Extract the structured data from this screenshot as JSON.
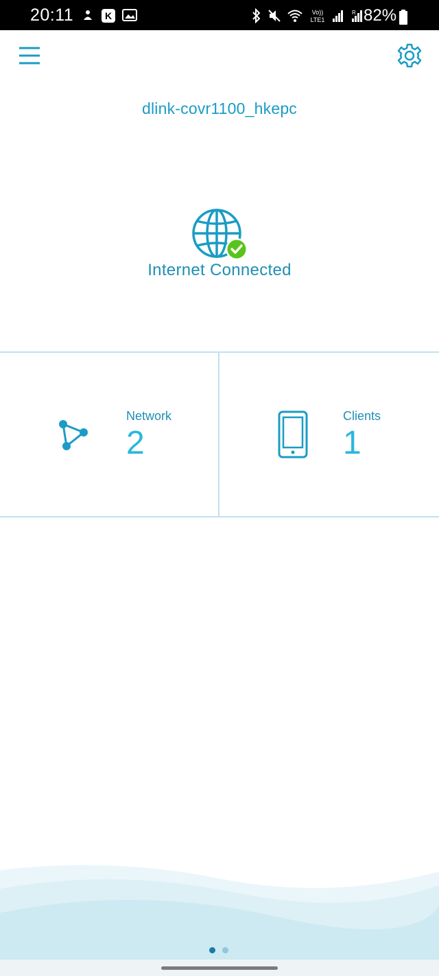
{
  "status_bar": {
    "time": "20:11",
    "battery": "82%",
    "left_icons": [
      "notification-icon",
      "k-app-icon",
      "gallery-icon"
    ],
    "right_icons": [
      "bluetooth-icon",
      "mute-icon",
      "wifi-icon",
      "volte-icon",
      "signal-icon",
      "roaming-signal-icon"
    ]
  },
  "header": {
    "menu_icon": "hamburger-menu-icon",
    "settings_icon": "gear-icon"
  },
  "network": {
    "name": "dlink-covr1100_hkepc"
  },
  "internet": {
    "status": "Internet Connected",
    "icon": "globe-icon",
    "badge_icon": "check-icon",
    "badge_color": "#5ac31b"
  },
  "tiles": {
    "network": {
      "label": "Network",
      "value": "2",
      "icon": "mesh-network-icon"
    },
    "clients": {
      "label": "Clients",
      "value": "1",
      "icon": "phone-icon"
    }
  },
  "pager": {
    "pages": 2,
    "current": 1
  },
  "colors": {
    "accent": "#1a9cc4",
    "accent_light": "#29b8dc",
    "divider": "#bfe2ee"
  }
}
